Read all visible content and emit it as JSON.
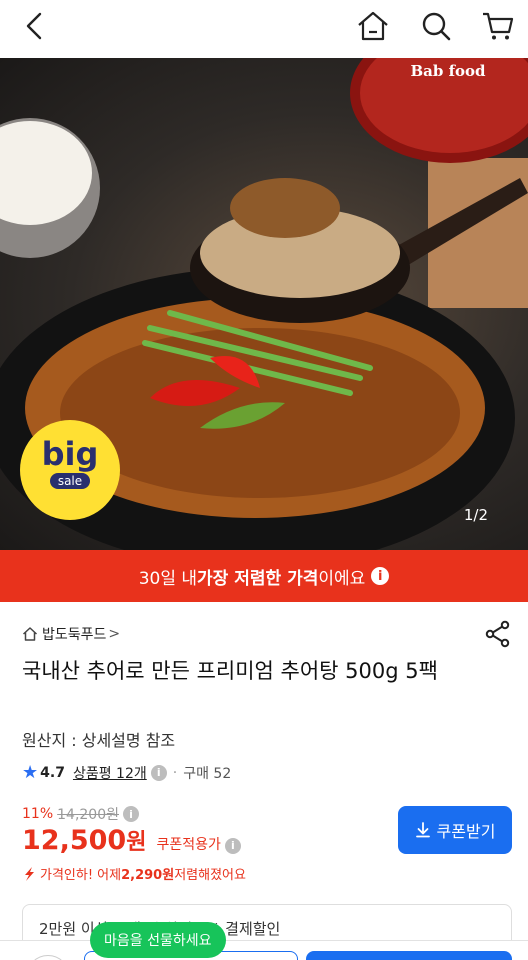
{
  "nav": {
    "back_icon": "chevron-left-icon",
    "home_icon": "home-icon",
    "search_icon": "search-icon",
    "cart_icon": "cart-icon"
  },
  "hero": {
    "brand_logo_text": "Bab food",
    "badge_top": "big",
    "badge_bottom": "sale",
    "counter": "1/2"
  },
  "promo": {
    "prefix": "30일 내 ",
    "highlight": "가장 저렴한 가격",
    "suffix": "이에요",
    "info_icon": "i"
  },
  "product": {
    "store_name": "밥도둑푸드",
    "store_chevron": ">",
    "title": "국내산 추어로 만든 프리미엄 추어탕 500g 5팩",
    "origin": "원산지 : 상세설명 참조",
    "rating": "4.7",
    "reviews": "상품평 12개",
    "purchases": "구매 52"
  },
  "price": {
    "discount_pct": "11%",
    "original_price": "14,200원",
    "sale_price": "12,500",
    "currency": "원",
    "coupon_label": "쿠폰적용가",
    "drop_prefix": "가격인하! 어제 ",
    "drop_amount": "2,290원",
    "drop_suffix": " 저렴해졌어요"
  },
  "coupon_button": {
    "label": "쿠폰받기"
  },
  "benefit": {
    "text": "2만원 이상 구매 시 최대 5% 결제할인"
  },
  "gift": {
    "label": "마음을 선물하세요"
  },
  "colors": {
    "accent_red": "#e8321c",
    "primary_blue": "#1a6ef0",
    "gift_green": "#17c45a"
  }
}
